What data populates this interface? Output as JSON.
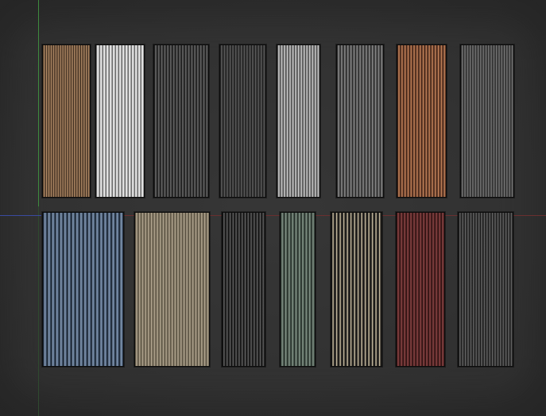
{
  "scene": {
    "axes": {
      "green": "#3e8a3e",
      "red": "#6a2f2f",
      "blue": "#3a4aa0"
    },
    "background": "#2d2d2d"
  },
  "panels": [
    {
      "name": "wood-brown-panel",
      "base": "#8a6a4e",
      "light": "#c49a72",
      "dark": "#3f2e20",
      "ribs": 20
    },
    {
      "name": "white-panel",
      "base": "#d8d8d8",
      "light": "#ffffff",
      "dark": "#6c6c6c",
      "ribs": 15
    },
    {
      "name": "charcoal-panel-1",
      "base": "#4a4a4a",
      "light": "#6e6e6e",
      "dark": "#1c1c1c",
      "ribs": 18
    },
    {
      "name": "dark-gray-panel",
      "base": "#454545",
      "light": "#626262",
      "dark": "#1e1e1e",
      "ribs": 16
    },
    {
      "name": "light-gray-panel",
      "base": "#a6a6a6",
      "light": "#d6d6d6",
      "dark": "#4a4a4a",
      "ribs": 15
    },
    {
      "name": "medium-gray-panel",
      "base": "#6a6a6a",
      "light": "#8e8e8e",
      "dark": "#2a2a2a",
      "ribs": 15
    },
    {
      "name": "copper-panel",
      "base": "#9a5f3e",
      "light": "#c98a62",
      "dark": "#3e2217",
      "ribs": 16
    },
    {
      "name": "slate-gray-panel",
      "base": "#5e5e5e",
      "light": "#7c7c7c",
      "dark": "#2a2a2a",
      "ribs": 20
    },
    {
      "name": "steel-blue-panel",
      "base": "#5a6e88",
      "light": "#8aa0bc",
      "dark": "#1f2a38",
      "ribs": 20
    },
    {
      "name": "beige-panel",
      "base": "#938874",
      "light": "#b9ad96",
      "dark": "#5a5242",
      "ribs": 25
    },
    {
      "name": "black-panel",
      "base": "#3a3a3a",
      "light": "#6a6a6a",
      "dark": "#101010",
      "ribs": 14
    },
    {
      "name": "sage-green-panel",
      "base": "#5f6f64",
      "light": "#8a9a8e",
      "dark": "#26302a",
      "ribs": 10
    },
    {
      "name": "black-cream-stripe-panel",
      "base": "#3a352e",
      "light": "#e6d8b8",
      "dark": "#151515",
      "ribs": 14
    },
    {
      "name": "burgundy-panel",
      "base": "#6a2f2f",
      "light": "#8e4a4a",
      "dark": "#2e1212",
      "ribs": 15
    },
    {
      "name": "graphite-panel",
      "base": "#4a4a4a",
      "light": "#6a6a6a",
      "dark": "#1a1a1a",
      "ribs": 20
    }
  ]
}
